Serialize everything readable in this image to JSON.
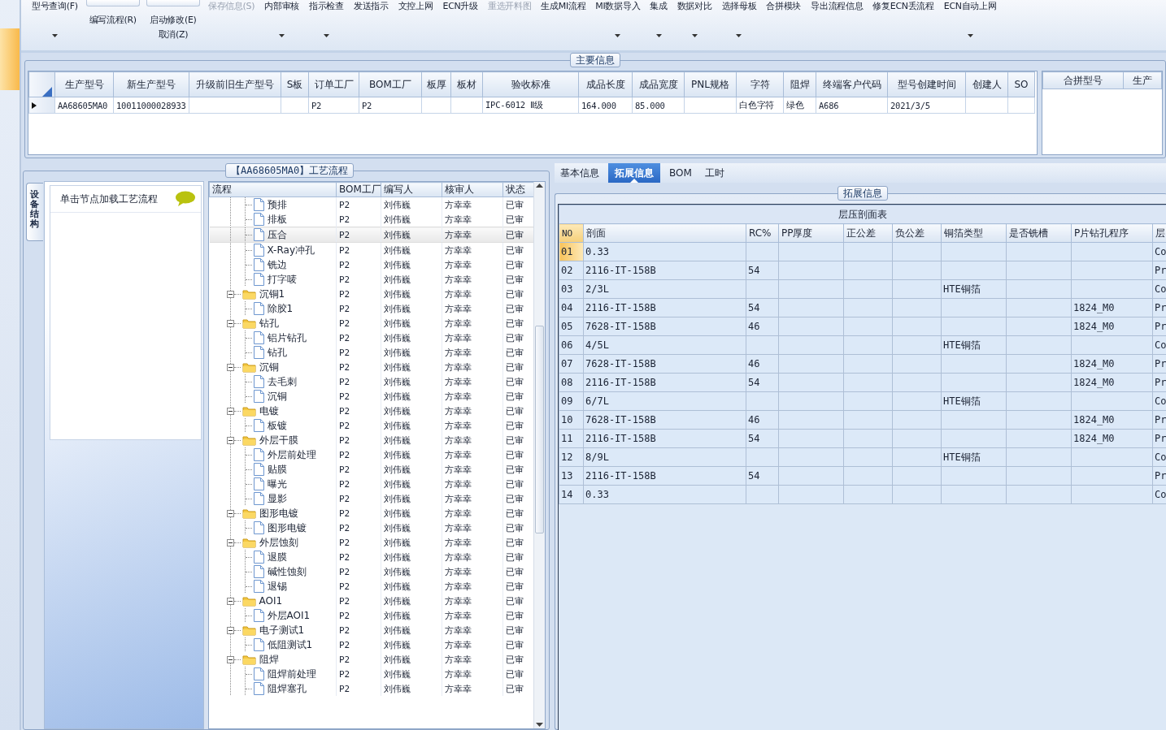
{
  "toolbar": {
    "groups": [
      {
        "kind": "large",
        "label": "型号查询(F)",
        "dropdown": true,
        "disabled": false
      },
      {
        "kind": "stack",
        "buttons": [
          "编写流程(R)"
        ]
      },
      {
        "kind": "stack",
        "buttons": [
          "启动修改(E)",
          "取消(Z)"
        ]
      },
      {
        "kind": "large",
        "label": "保存信息(S)",
        "dropdown": false,
        "disabled": true
      },
      {
        "kind": "large",
        "label": "内部审核",
        "dropdown": true,
        "disabled": false
      },
      {
        "kind": "large",
        "label": "指示检查",
        "dropdown": true,
        "disabled": false
      },
      {
        "kind": "large",
        "label": "发送指示",
        "dropdown": false,
        "disabled": false
      },
      {
        "kind": "large",
        "label": "文控上网",
        "dropdown": false,
        "disabled": false
      },
      {
        "kind": "large",
        "label": "ECN升级",
        "dropdown": false,
        "disabled": false
      },
      {
        "kind": "large",
        "label": "重选开料图",
        "dropdown": false,
        "disabled": true
      },
      {
        "kind": "large",
        "label": "生成MI流程",
        "dropdown": false,
        "disabled": false
      },
      {
        "kind": "large",
        "label": "MI数据导入",
        "dropdown": true,
        "disabled": false
      },
      {
        "kind": "large",
        "label": "集成",
        "dropdown": true,
        "disabled": false
      },
      {
        "kind": "large",
        "label": "数据对比",
        "dropdown": true,
        "disabled": false
      },
      {
        "kind": "large",
        "label": "选择母板",
        "dropdown": true,
        "disabled": false
      },
      {
        "kind": "large",
        "label": "合拼模块",
        "dropdown": false,
        "disabled": false
      },
      {
        "kind": "large",
        "label": "导出流程信息",
        "dropdown": false,
        "disabled": false
      },
      {
        "kind": "large",
        "label": "修复ECN丢流程",
        "dropdown": false,
        "disabled": false
      },
      {
        "kind": "large",
        "label": "ECN自动上网",
        "dropdown": true,
        "disabled": false
      }
    ]
  },
  "main_info": {
    "title": "主要信息",
    "columns": [
      "生产型号",
      "新生产型号",
      "升级前旧生产型号",
      "S板",
      "订单工厂",
      "BOM工厂",
      "板厚",
      "板材",
      "验收标准",
      "成品长度",
      "成品宽度",
      "PNL规格",
      "字符",
      "阻焊",
      "终端客户代码",
      "型号创建时间",
      "创建人",
      "SO"
    ],
    "rows": [
      {
        "current": true,
        "cells": [
          "AA68605MA0",
          "10011000028933",
          null,
          null,
          "P2",
          "P2",
          null,
          null,
          "IPC-6012 Ⅱ级",
          "164.000",
          "85.000",
          null,
          "白色字符",
          "绿色",
          "A686",
          "2021/3/5",
          null,
          null
        ]
      }
    ]
  },
  "merge_grid": {
    "columns": [
      "合拼型号",
      "生产"
    ]
  },
  "process_panel": {
    "title": "【AA68605MA0】工艺流程",
    "side_tab": "设备结构",
    "hint": "单击节点加载工艺流程",
    "tree": {
      "columns": [
        "流程",
        "BOM工厂",
        "编写人",
        "核审人",
        "状态"
      ],
      "rows": [
        {
          "children": [
            {
              "kind": "step",
              "label": "预排",
              "bom": "P2",
              "author": "刘伟巍",
              "reviewer": "方幸幸",
              "status": "已审",
              "selected": false
            },
            {
              "kind": "step",
              "label": "排板",
              "bom": "P2",
              "author": "刘伟巍",
              "reviewer": "方幸幸",
              "status": "已审",
              "selected": false
            },
            {
              "kind": "step",
              "label": "压合",
              "bom": "P2",
              "author": "刘伟巍",
              "reviewer": "方幸幸",
              "status": "已审",
              "selected": true
            },
            {
              "kind": "step",
              "label": "X-Ray冲孔",
              "bom": "P2",
              "author": "刘伟巍",
              "reviewer": "方幸幸",
              "status": "已审",
              "selected": false
            },
            {
              "kind": "step",
              "label": "铣边",
              "bom": "P2",
              "author": "刘伟巍",
              "reviewer": "方幸幸",
              "status": "已审",
              "selected": false
            },
            {
              "kind": "step",
              "label": "打字唛",
              "bom": "P2",
              "author": "刘伟巍",
              "reviewer": "方幸幸",
              "status": "已审",
              "selected": false
            }
          ]
        },
        {
          "kind": "folder",
          "label": "沉铜1",
          "bom": "P2",
          "author": "刘伟巍",
          "reviewer": "方幸幸",
          "status": "已审",
          "selected": false,
          "expanded": true,
          "children": [
            {
              "kind": "step",
              "label": "除胶1",
              "bom": "P2",
              "author": "刘伟巍",
              "reviewer": "方幸幸",
              "status": "已审",
              "selected": false
            }
          ]
        },
        {
          "kind": "folder",
          "label": "钻孔",
          "bom": "P2",
          "author": "刘伟巍",
          "reviewer": "方幸幸",
          "status": "已审",
          "selected": false,
          "expanded": true,
          "children": [
            {
              "kind": "step",
              "label": "铝片钻孔",
              "bom": "P2",
              "author": "刘伟巍",
              "reviewer": "方幸幸",
              "status": "已审",
              "selected": false
            },
            {
              "kind": "step",
              "label": "钻孔",
              "bom": "P2",
              "author": "刘伟巍",
              "reviewer": "方幸幸",
              "status": "已审",
              "selected": false
            }
          ]
        },
        {
          "kind": "folder",
          "label": "沉铜",
          "bom": "P2",
          "author": "刘伟巍",
          "reviewer": "方幸幸",
          "status": "已审",
          "selected": false,
          "expanded": true,
          "children": [
            {
              "kind": "step",
              "label": "去毛刺",
              "bom": "P2",
              "author": "刘伟巍",
              "reviewer": "方幸幸",
              "status": "已审",
              "selected": false
            },
            {
              "kind": "step",
              "label": "沉铜",
              "bom": "P2",
              "author": "刘伟巍",
              "reviewer": "方幸幸",
              "status": "已审",
              "selected": false
            }
          ]
        },
        {
          "kind": "folder",
          "label": "电镀",
          "bom": "P2",
          "author": "刘伟巍",
          "reviewer": "方幸幸",
          "status": "已审",
          "selected": false,
          "expanded": true,
          "children": [
            {
              "kind": "step",
              "label": "板镀",
              "bom": "P2",
              "author": "刘伟巍",
              "reviewer": "方幸幸",
              "status": "已审",
              "selected": false
            }
          ]
        },
        {
          "kind": "folder",
          "label": "外层干膜",
          "bom": "P2",
          "author": "刘伟巍",
          "reviewer": "方幸幸",
          "status": "已审",
          "selected": false,
          "expanded": true,
          "children": [
            {
              "kind": "step",
              "label": "外层前处理",
              "bom": "P2",
              "author": "刘伟巍",
              "reviewer": "方幸幸",
              "status": "已审",
              "selected": false
            },
            {
              "kind": "step",
              "label": "贴膜",
              "bom": "P2",
              "author": "刘伟巍",
              "reviewer": "方幸幸",
              "status": "已审",
              "selected": false
            },
            {
              "kind": "step",
              "label": "曝光",
              "bom": "P2",
              "author": "刘伟巍",
              "reviewer": "方幸幸",
              "status": "已审",
              "selected": false
            },
            {
              "kind": "step",
              "label": "显影",
              "bom": "P2",
              "author": "刘伟巍",
              "reviewer": "方幸幸",
              "status": "已审",
              "selected": false
            }
          ]
        },
        {
          "kind": "folder",
          "label": "图形电镀",
          "bom": "P2",
          "author": "刘伟巍",
          "reviewer": "方幸幸",
          "status": "已审",
          "selected": false,
          "expanded": true,
          "children": [
            {
              "kind": "step",
              "label": "图形电镀",
              "bom": "P2",
              "author": "刘伟巍",
              "reviewer": "方幸幸",
              "status": "已审",
              "selected": false
            }
          ]
        },
        {
          "kind": "folder",
          "label": "外层蚀刻",
          "bom": "P2",
          "author": "刘伟巍",
          "reviewer": "方幸幸",
          "status": "已审",
          "selected": false,
          "expanded": true,
          "children": [
            {
              "kind": "step",
              "label": "退膜",
              "bom": "P2",
              "author": "刘伟巍",
              "reviewer": "方幸幸",
              "status": "已审",
              "selected": false
            },
            {
              "kind": "step",
              "label": "碱性蚀刻",
              "bom": "P2",
              "author": "刘伟巍",
              "reviewer": "方幸幸",
              "status": "已审",
              "selected": false
            },
            {
              "kind": "step",
              "label": "退锡",
              "bom": "P2",
              "author": "刘伟巍",
              "reviewer": "方幸幸",
              "status": "已审",
              "selected": false
            }
          ]
        },
        {
          "kind": "folder",
          "label": "AOI1",
          "bom": "P2",
          "author": "刘伟巍",
          "reviewer": "方幸幸",
          "status": "已审",
          "selected": false,
          "expanded": true,
          "children": [
            {
              "kind": "step",
              "label": "外层AOI1",
              "bom": "P2",
              "author": "刘伟巍",
              "reviewer": "方幸幸",
              "status": "已审",
              "selected": false
            }
          ]
        },
        {
          "kind": "folder",
          "label": "电子测试1",
          "bom": "P2",
          "author": "刘伟巍",
          "reviewer": "方幸幸",
          "status": "已审",
          "selected": false,
          "expanded": true,
          "children": [
            {
              "kind": "step",
              "label": "低阻测试1",
              "bom": "P2",
              "author": "刘伟巍",
              "reviewer": "方幸幸",
              "status": "已审",
              "selected": false
            }
          ]
        },
        {
          "kind": "folder",
          "label": "阻焊",
          "bom": "P2",
          "author": "刘伟巍",
          "reviewer": "方幸幸",
          "status": "已审",
          "selected": false,
          "expanded": true,
          "children": [
            {
              "kind": "step",
              "label": "阻焊前处理",
              "bom": "P2",
              "author": "刘伟巍",
              "reviewer": "方幸幸",
              "status": "已审",
              "selected": false
            },
            {
              "kind": "step",
              "label": "阻焊塞孔",
              "bom": "P2",
              "author": "刘伟巍",
              "reviewer": "方幸幸",
              "status": "已审",
              "selected": false
            }
          ]
        }
      ]
    }
  },
  "ext_panel": {
    "tabs": [
      {
        "label": "基本信息",
        "selected": false
      },
      {
        "label": "拓展信息",
        "selected": true
      },
      {
        "label": "BOM",
        "selected": false
      },
      {
        "label": "工时",
        "selected": false
      }
    ],
    "group_title": "拓展信息",
    "table": {
      "caption": "层压剖面表",
      "columns": [
        "NO",
        "剖面",
        "RC%",
        "PP厚度",
        "正公差",
        "负公差",
        "铜箔类型",
        "是否铣槽",
        "P片钻孔程序",
        "层"
      ],
      "rows": [
        {
          "current": true,
          "cells": [
            "01",
            "0.33",
            null,
            null,
            null,
            null,
            null,
            null,
            null,
            "Co"
          ]
        },
        {
          "current": false,
          "cells": [
            "02",
            "2116-IT-158B",
            "54",
            null,
            null,
            null,
            null,
            null,
            null,
            "Pr"
          ]
        },
        {
          "current": false,
          "cells": [
            "03",
            "2/3L",
            null,
            null,
            null,
            null,
            "HTE铜箔",
            null,
            null,
            "Co"
          ]
        },
        {
          "current": false,
          "cells": [
            "04",
            "2116-IT-158B",
            "54",
            null,
            null,
            null,
            null,
            null,
            "1824_M0",
            "Pr"
          ]
        },
        {
          "current": false,
          "cells": [
            "05",
            "7628-IT-158B",
            "46",
            null,
            null,
            null,
            null,
            null,
            "1824_M0",
            "Pr"
          ]
        },
        {
          "current": false,
          "cells": [
            "06",
            "4/5L",
            null,
            null,
            null,
            null,
            "HTE铜箔",
            null,
            null,
            "Co"
          ]
        },
        {
          "current": false,
          "cells": [
            "07",
            "7628-IT-158B",
            "46",
            null,
            null,
            null,
            null,
            null,
            "1824_M0",
            "Pr"
          ]
        },
        {
          "current": false,
          "cells": [
            "08",
            "2116-IT-158B",
            "54",
            null,
            null,
            null,
            null,
            null,
            "1824_M0",
            "Pr"
          ]
        },
        {
          "current": false,
          "cells": [
            "09",
            "6/7L",
            null,
            null,
            null,
            null,
            "HTE铜箔",
            null,
            null,
            "Co"
          ]
        },
        {
          "current": false,
          "cells": [
            "10",
            "7628-IT-158B",
            "46",
            null,
            null,
            null,
            null,
            null,
            "1824_M0",
            "Pr"
          ]
        },
        {
          "current": false,
          "cells": [
            "11",
            "2116-IT-158B",
            "54",
            null,
            null,
            null,
            null,
            null,
            "1824_M0",
            "Pr"
          ]
        },
        {
          "current": false,
          "cells": [
            "12",
            "8/9L",
            null,
            null,
            null,
            null,
            "HTE铜箔",
            null,
            null,
            "Co"
          ]
        },
        {
          "current": false,
          "cells": [
            "13",
            "2116-IT-158B",
            "54",
            null,
            null,
            null,
            null,
            null,
            null,
            "Pr"
          ]
        },
        {
          "current": false,
          "cells": [
            "14",
            "0.33",
            null,
            null,
            null,
            null,
            null,
            null,
            null,
            "Co"
          ]
        }
      ]
    }
  }
}
